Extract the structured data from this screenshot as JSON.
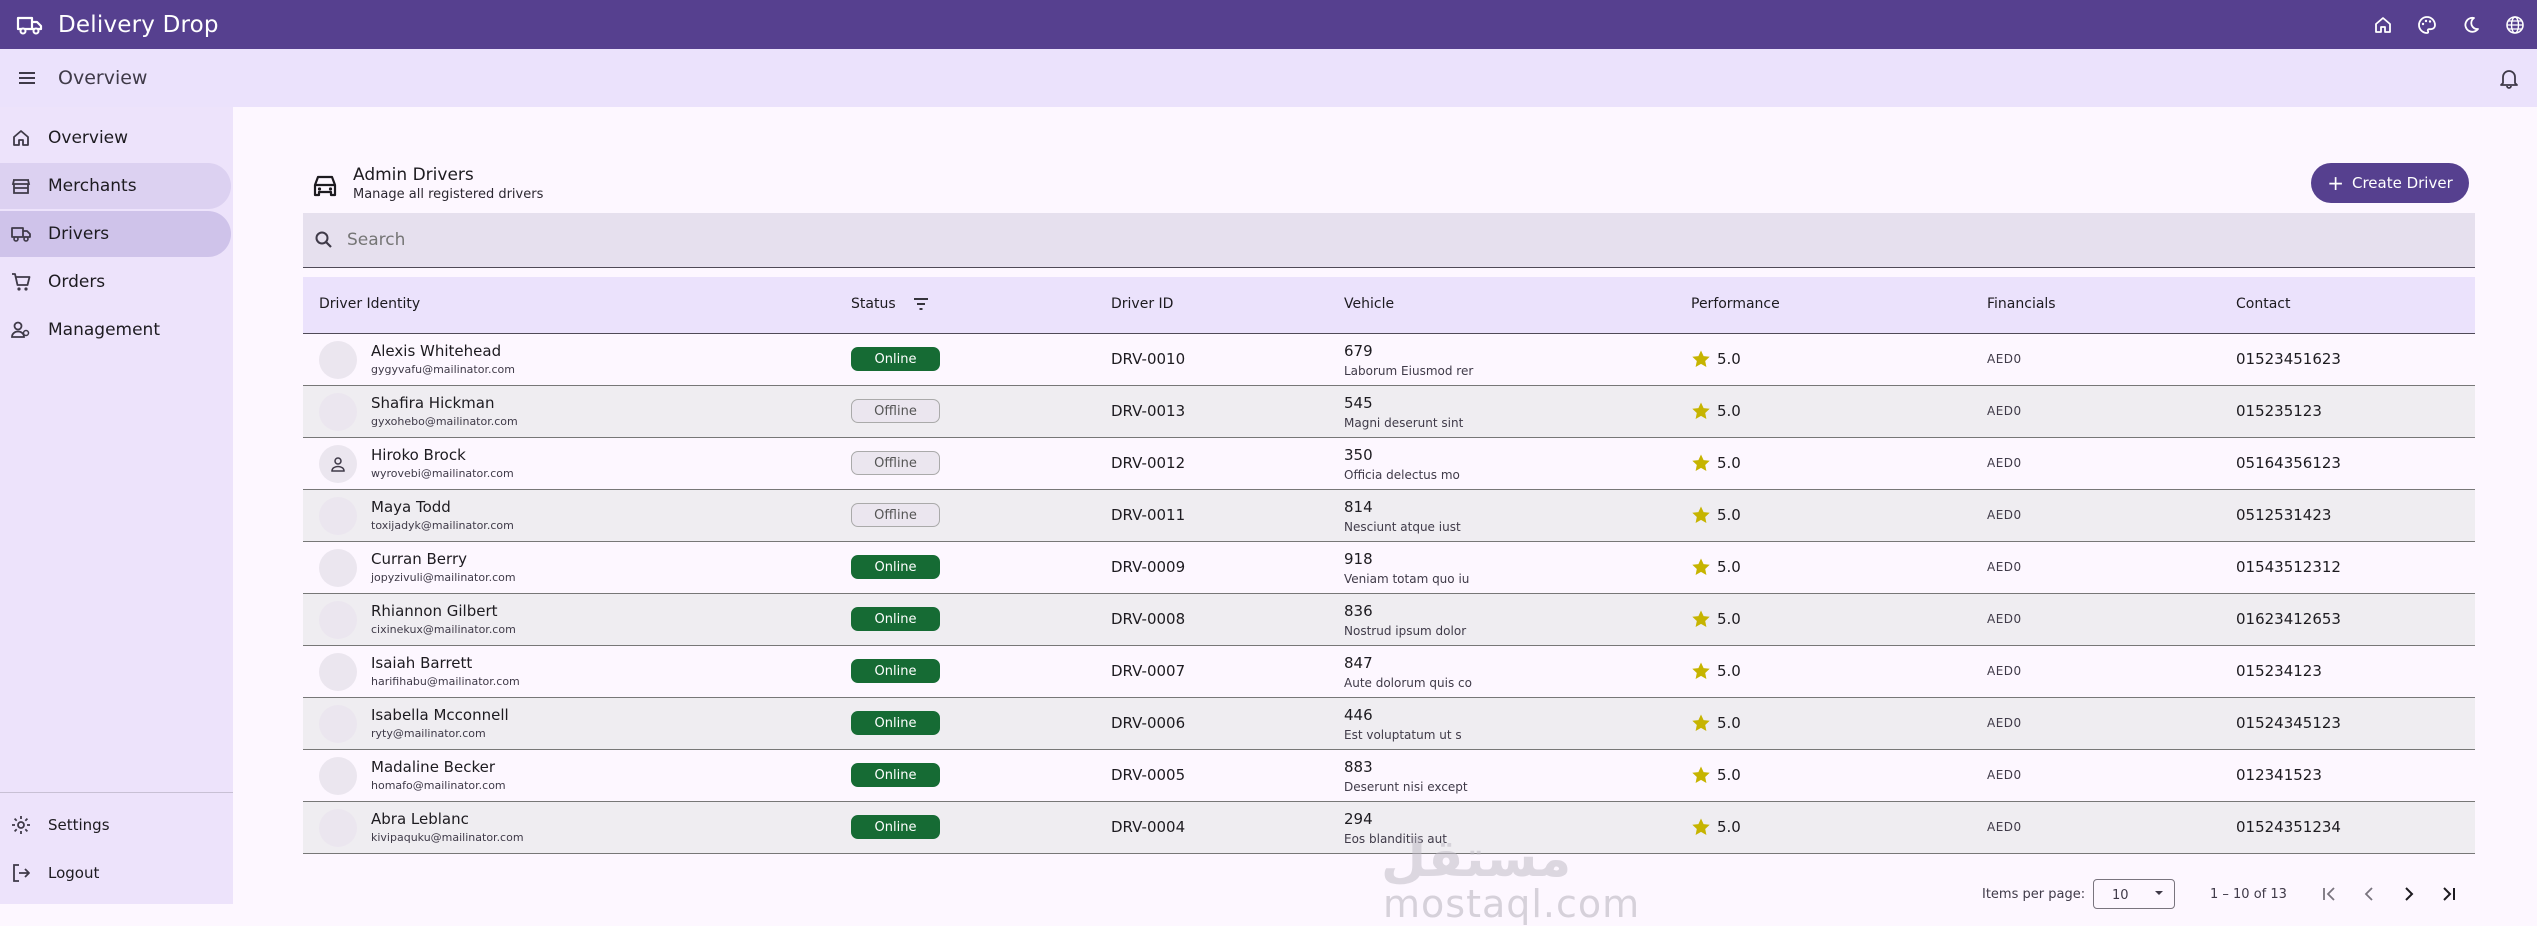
{
  "app": {
    "title": "Delivery Drop"
  },
  "subbar": {
    "title": "Overview"
  },
  "sidebar": {
    "items": [
      {
        "label": "Overview",
        "icon": "home-icon"
      },
      {
        "label": "Merchants",
        "icon": "store-icon"
      },
      {
        "label": "Drivers",
        "icon": "truck-icon"
      },
      {
        "label": "Orders",
        "icon": "cart-icon"
      },
      {
        "label": "Management",
        "icon": "people-icon"
      }
    ],
    "footer": [
      {
        "label": "Settings",
        "icon": "gear-icon"
      },
      {
        "label": "Logout",
        "icon": "logout-icon"
      }
    ]
  },
  "header": {
    "title": "Admin Drivers",
    "subtitle": "Manage all registered drivers",
    "create_label": "Create Driver"
  },
  "search": {
    "placeholder": "Search"
  },
  "table": {
    "columns": [
      "Driver Identity",
      "Status",
      "Driver ID",
      "Vehicle",
      "Performance",
      "Financials",
      "Contact"
    ],
    "rows": [
      {
        "name": "Alexis Whitehead",
        "email": "gygyvafu@mailinator.com",
        "status": "Online",
        "id": "DRV-0010",
        "vehicle_num": "679",
        "vehicle_name": "Laborum Eiusmod rer",
        "performance": "5.0",
        "financials": "AED0",
        "contact": "01523451623"
      },
      {
        "name": "Shafira Hickman",
        "email": "gyxohebo@mailinator.com",
        "status": "Offline",
        "id": "DRV-0013",
        "vehicle_num": "545",
        "vehicle_name": "Magni deserunt sint",
        "performance": "5.0",
        "financials": "AED0",
        "contact": "015235123"
      },
      {
        "name": "Hiroko Brock",
        "email": "wyrovebi@mailinator.com",
        "status": "Offline",
        "id": "DRV-0012",
        "vehicle_num": "350",
        "vehicle_name": "Officia delectus mo",
        "performance": "5.0",
        "financials": "AED0",
        "contact": "05164356123"
      },
      {
        "name": "Maya Todd",
        "email": "toxijadyk@mailinator.com",
        "status": "Offline",
        "id": "DRV-0011",
        "vehicle_num": "814",
        "vehicle_name": "Nesciunt atque iust",
        "performance": "5.0",
        "financials": "AED0",
        "contact": "0512531423"
      },
      {
        "name": "Curran Berry",
        "email": "jopyzivuli@mailinator.com",
        "status": "Online",
        "id": "DRV-0009",
        "vehicle_num": "918",
        "vehicle_name": "Veniam totam quo iu",
        "performance": "5.0",
        "financials": "AED0",
        "contact": "01543512312"
      },
      {
        "name": "Rhiannon Gilbert",
        "email": "cixinekux@mailinator.com",
        "status": "Online",
        "id": "DRV-0008",
        "vehicle_num": "836",
        "vehicle_name": "Nostrud ipsum dolor",
        "performance": "5.0",
        "financials": "AED0",
        "contact": "01623412653"
      },
      {
        "name": "Isaiah Barrett",
        "email": "harifihabu@mailinator.com",
        "status": "Online",
        "id": "DRV-0007",
        "vehicle_num": "847",
        "vehicle_name": "Aute dolorum quis co",
        "performance": "5.0",
        "financials": "AED0",
        "contact": "015234123"
      },
      {
        "name": "Isabella Mcconnell",
        "email": "ryty@mailinator.com",
        "status": "Online",
        "id": "DRV-0006",
        "vehicle_num": "446",
        "vehicle_name": "Est voluptatum ut s",
        "performance": "5.0",
        "financials": "AED0",
        "contact": "01524345123"
      },
      {
        "name": "Madaline Becker",
        "email": "homafo@mailinator.com",
        "status": "Online",
        "id": "DRV-0005",
        "vehicle_num": "883",
        "vehicle_name": "Deserunt nisi except",
        "performance": "5.0",
        "financials": "AED0",
        "contact": "012341523"
      },
      {
        "name": "Abra Leblanc",
        "email": "kivipaquku@mailinator.com",
        "status": "Online",
        "id": "DRV-0004",
        "vehicle_num": "294",
        "vehicle_name": "Eos blanditiis aut",
        "performance": "5.0",
        "financials": "AED0",
        "contact": "01524351234"
      }
    ]
  },
  "pagination": {
    "items_per_page_label": "Items per page:",
    "items_per_page": "10",
    "range": "1 – 10 of 13"
  },
  "watermark": {
    "arabic": "مستقل",
    "latin": "mostaql.com"
  },
  "colors": {
    "primary": "#56408f",
    "online": "#166b34",
    "star": "#c6b400"
  }
}
